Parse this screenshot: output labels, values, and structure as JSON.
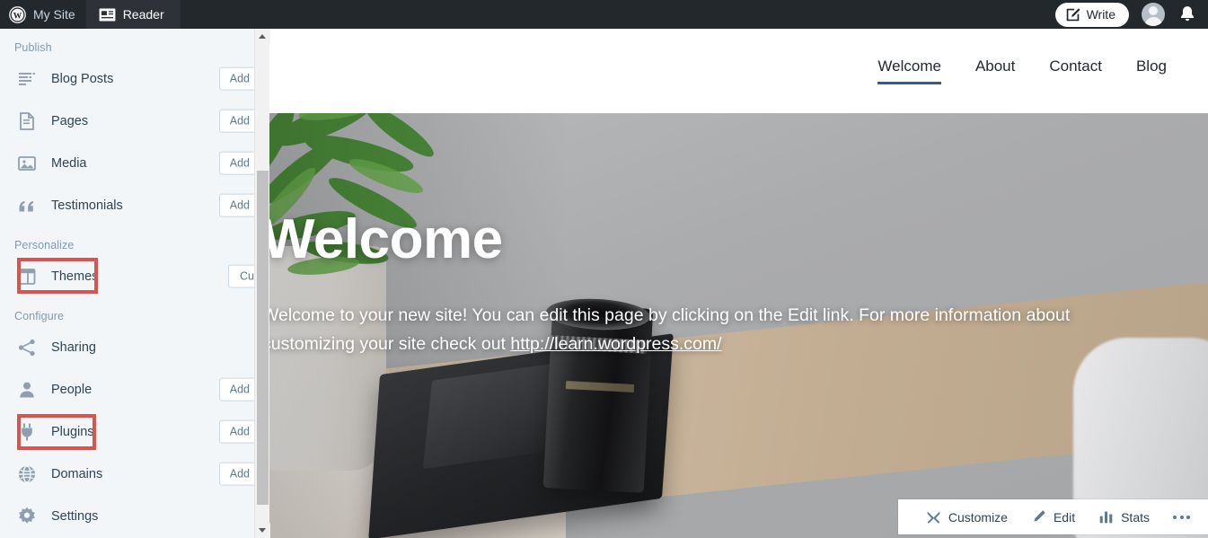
{
  "masterbar": {
    "my_site": {
      "label": "My Site",
      "icon": "wordpress-logo-icon"
    },
    "reader": {
      "label": "Reader",
      "icon": "reader-icon"
    },
    "write": {
      "label": "Write",
      "icon": "pencil-square-icon"
    },
    "avatar": {
      "name": "user-avatar"
    },
    "notifications": {
      "icon": "bell-icon"
    }
  },
  "sidebar": {
    "sections": [
      {
        "label": "Publish",
        "items": [
          {
            "label": "Blog Posts",
            "icon": "list-lines-icon",
            "action": "Add"
          },
          {
            "label": "Pages",
            "icon": "document-icon",
            "action": "Add"
          },
          {
            "label": "Media",
            "icon": "image-icon",
            "action": "Add"
          },
          {
            "label": "Testimonials",
            "icon": "quote-icon",
            "action": "Add"
          }
        ]
      },
      {
        "label": "Personalize",
        "items": [
          {
            "label": "Themes",
            "icon": "layout-grid-icon",
            "action": "Customize",
            "highlighted": true
          }
        ]
      },
      {
        "label": "Configure",
        "items": [
          {
            "label": "Sharing",
            "icon": "share-nodes-icon",
            "action": ""
          },
          {
            "label": "People",
            "icon": "user-icon",
            "action": "Add"
          },
          {
            "label": "Plugins",
            "icon": "plug-icon",
            "action": "Add",
            "highlighted": true
          },
          {
            "label": "Domains",
            "icon": "globe-icon",
            "action": "Add"
          },
          {
            "label": "Settings",
            "icon": "gear-icon",
            "action": ""
          }
        ]
      }
    ],
    "highlight_color": "#d9534f",
    "scrollbar": {
      "up": "scroll-up-arrow",
      "down": "scroll-down-arrow"
    }
  },
  "site_preview": {
    "nav": [
      {
        "label": "Welcome",
        "active": true
      },
      {
        "label": "About",
        "active": false
      },
      {
        "label": "Contact",
        "active": false
      },
      {
        "label": "Blog",
        "active": false
      }
    ],
    "hero": {
      "title": "Welcome",
      "body_before_link": "Welcome to your new site! You can edit this page by clicking on the Edit link. For more information about customizing your site check out ",
      "link_text": "http://learn.wordpress.com/"
    },
    "actions": [
      {
        "label": "Customize",
        "icon": "tools-icon"
      },
      {
        "label": "Edit",
        "icon": "pencil-icon"
      },
      {
        "label": "Stats",
        "icon": "bar-chart-icon"
      }
    ],
    "more_menu": "ellipsis-icon"
  },
  "colors": {
    "masterbar_bg": "#23282d",
    "sidebar_bg": "#f3f6f8",
    "accent_blue": "#2f5d8c",
    "highlight_red": "#d9534f",
    "label_blue": "#7f9bb0"
  }
}
